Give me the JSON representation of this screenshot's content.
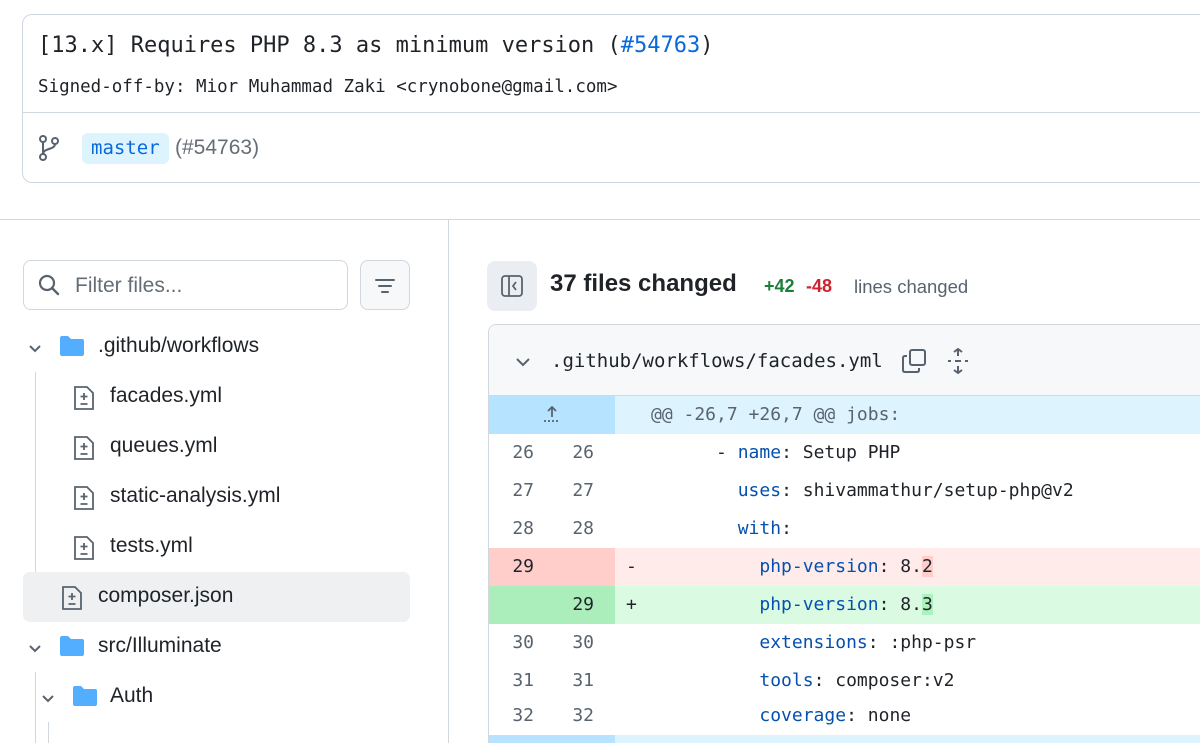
{
  "commit": {
    "title_prefix": "[13.x] Requires PHP 8.3 as minimum version (",
    "pr_link": "#54763",
    "title_suffix": ")",
    "signoff": "Signed-off-by: Mior Muhammad Zaki <crynobone@gmail.com>",
    "branch": "master",
    "branch_ref": "(#54763)"
  },
  "sidebar": {
    "filter_placeholder": "Filter files...",
    "tree": [
      {
        "type": "folder",
        "label": ".github/workflows",
        "expanded": true
      },
      {
        "type": "file",
        "label": "facades.yml"
      },
      {
        "type": "file",
        "label": "queues.yml"
      },
      {
        "type": "file",
        "label": "static-analysis.yml"
      },
      {
        "type": "file",
        "label": "tests.yml"
      },
      {
        "type": "file",
        "label": "composer.json",
        "selected": true
      },
      {
        "type": "folder",
        "label": "src/Illuminate",
        "expanded": true
      },
      {
        "type": "folder",
        "label": "Auth",
        "expanded": true
      }
    ]
  },
  "diff_summary": {
    "files_changed": "37 files changed",
    "additions": "+42",
    "deletions": "-48",
    "lines_label": "lines changed"
  },
  "diff_file": {
    "filename": ".github/workflows/facades.yml",
    "hunk_header": "@@ -26,7 +26,7 @@ jobs:",
    "lines": [
      {
        "old": "26",
        "new": "26",
        "mark": "",
        "indent": "      - ",
        "key": "name",
        "sep": ": ",
        "value": "Setup PHP",
        "type": "context"
      },
      {
        "old": "27",
        "new": "27",
        "mark": "",
        "indent": "        ",
        "key": "uses",
        "sep": ": ",
        "value": "shivammathur/setup-php@v2",
        "type": "context"
      },
      {
        "old": "28",
        "new": "28",
        "mark": "",
        "indent": "        ",
        "key": "with",
        "sep": ":",
        "value": "",
        "type": "context"
      },
      {
        "old": "29",
        "new": "",
        "mark": "-",
        "indent": "          ",
        "key": "php-version",
        "sep": ": ",
        "value_pre": "8.",
        "value_hl": "2",
        "type": "del"
      },
      {
        "old": "",
        "new": "29",
        "mark": "+",
        "indent": "          ",
        "key": "php-version",
        "sep": ": ",
        "value_pre": "8.",
        "value_hl": "3",
        "type": "add"
      },
      {
        "old": "30",
        "new": "30",
        "mark": "",
        "indent": "          ",
        "key": "extensions",
        "sep": ": ",
        "value": ":php-psr",
        "type": "context"
      },
      {
        "old": "31",
        "new": "31",
        "mark": "",
        "indent": "          ",
        "key": "tools",
        "sep": ": ",
        "value": "composer:v2",
        "type": "context"
      },
      {
        "old": "32",
        "new": "32",
        "mark": "",
        "indent": "          ",
        "key": "coverage",
        "sep": ": ",
        "value": "none",
        "type": "context"
      }
    ]
  },
  "colors": {
    "link": "#0969da",
    "addition": "#1a7f37",
    "deletion": "#cf222e",
    "border": "#d0d7de"
  }
}
